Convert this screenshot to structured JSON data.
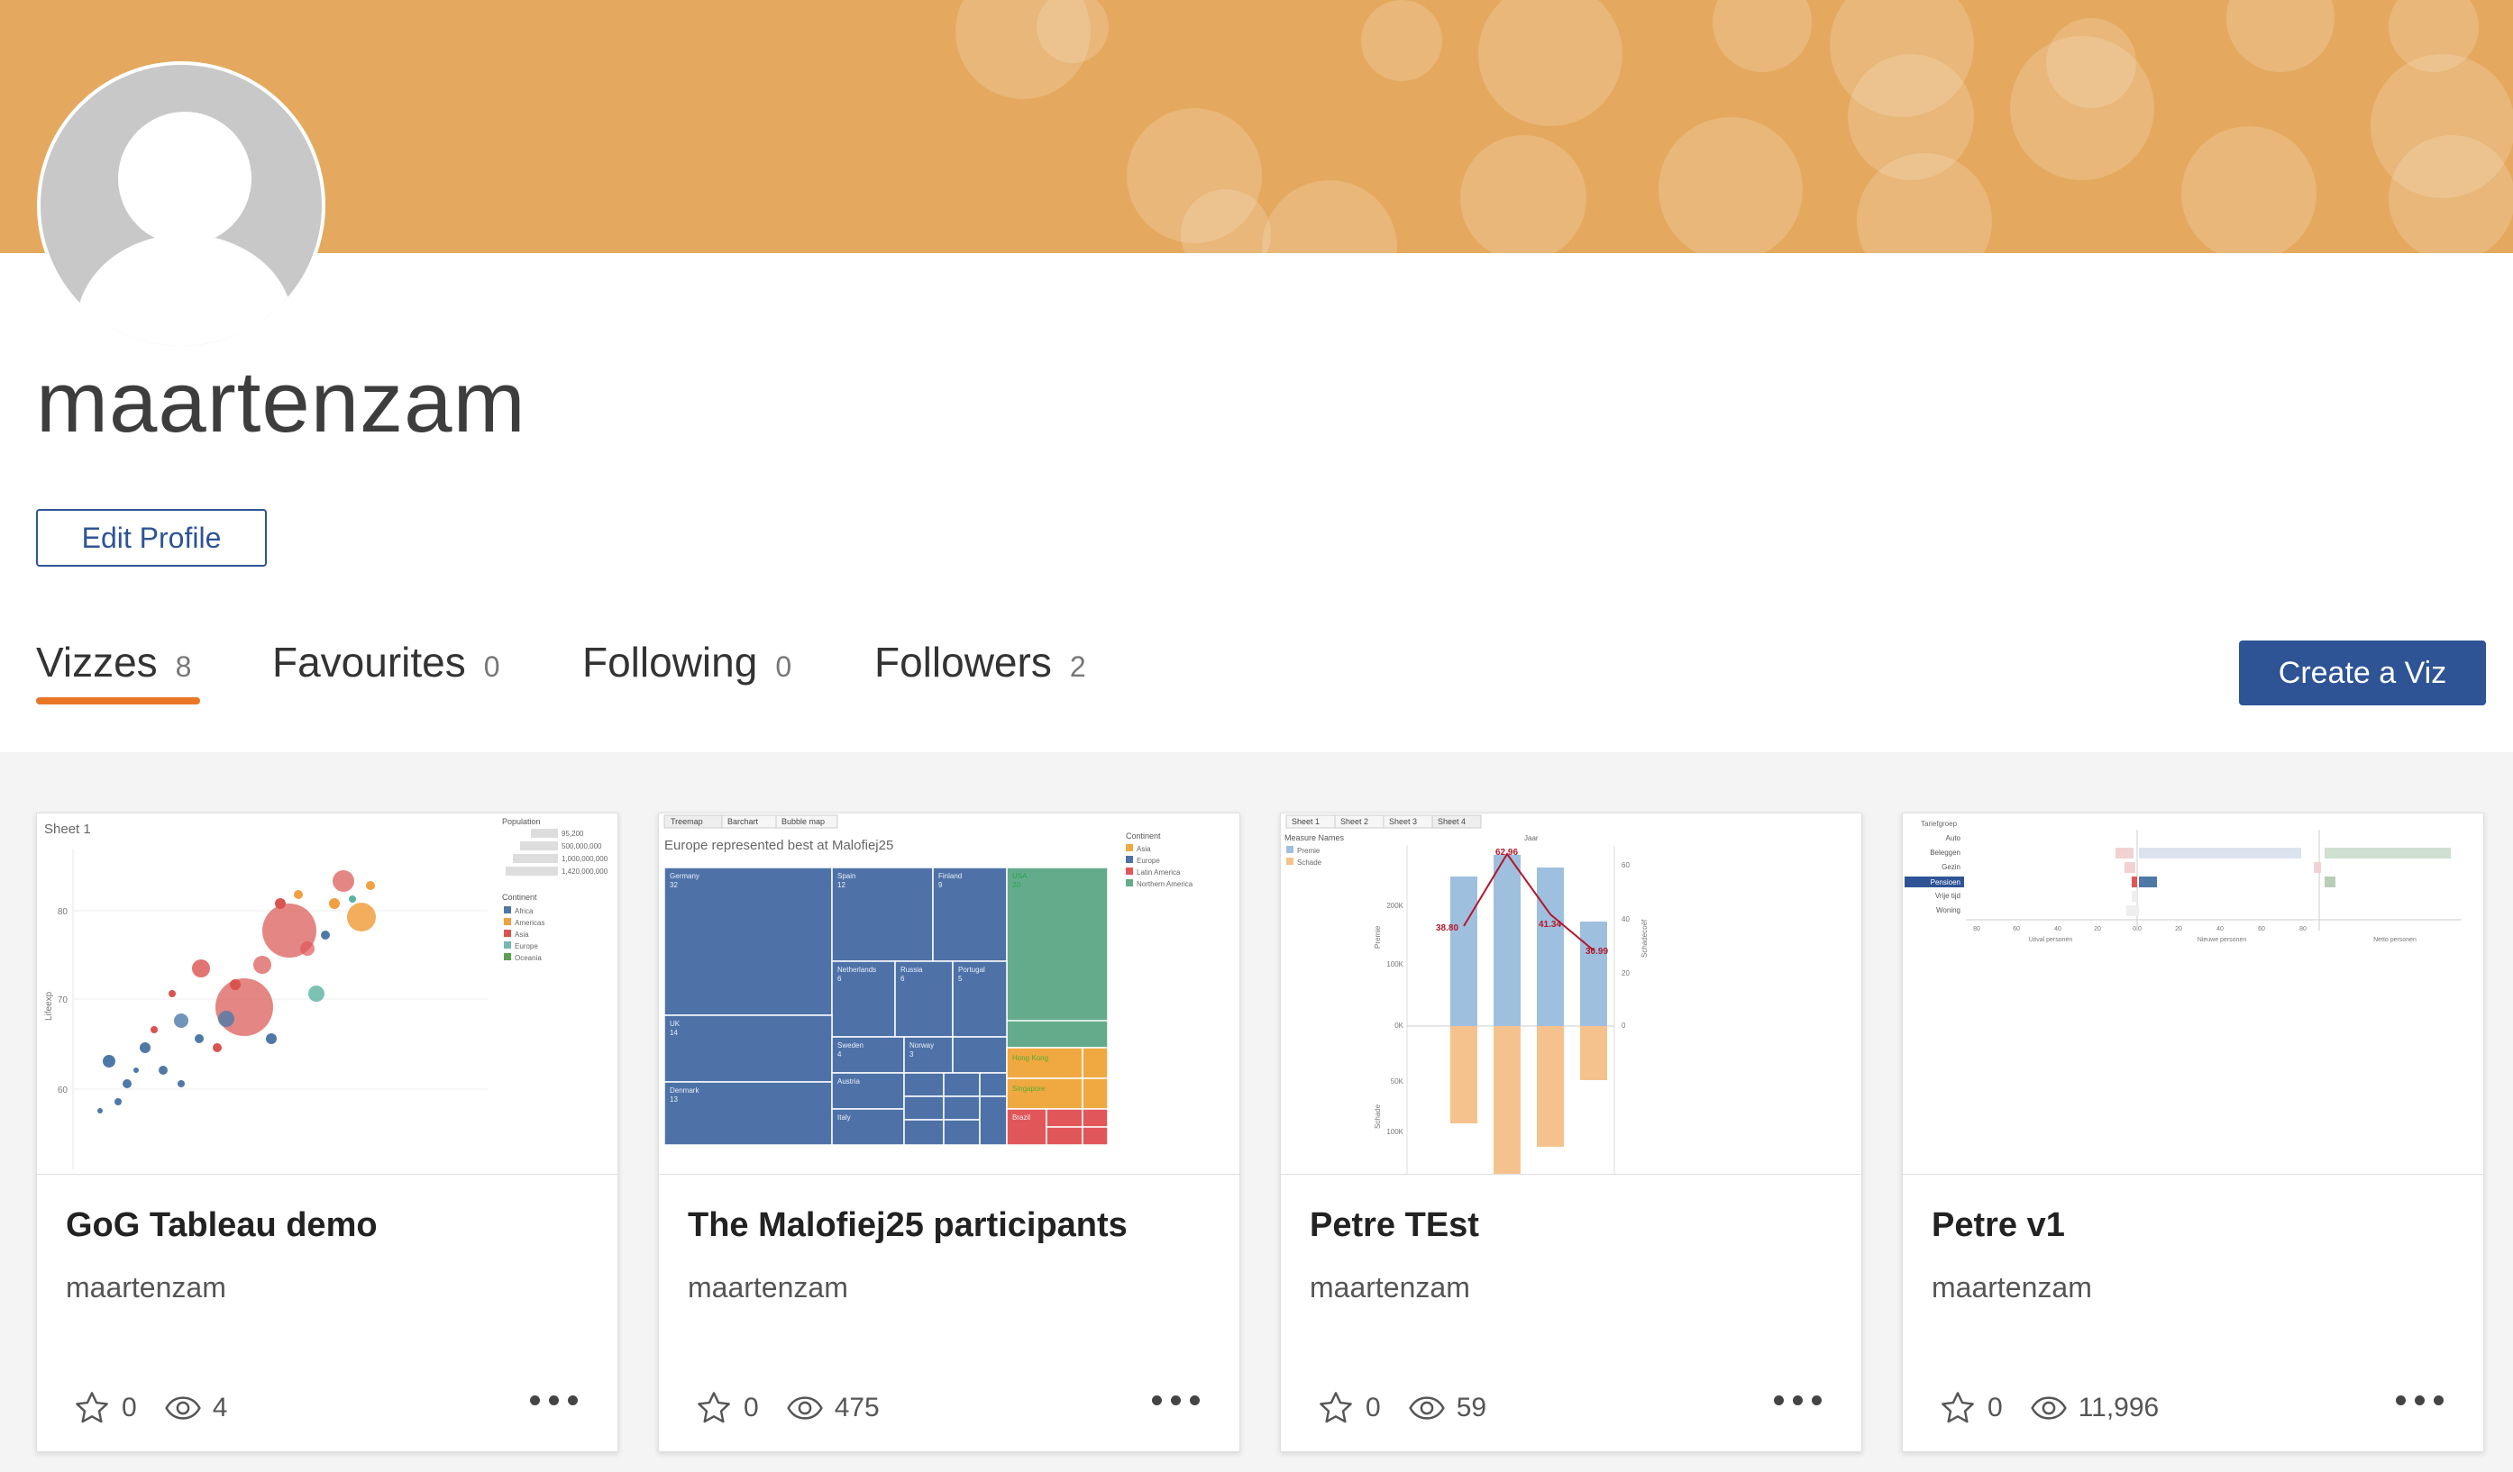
{
  "profile": {
    "username": "maartenzam",
    "edit_label": "Edit Profile",
    "banner_color": "#e4a95e"
  },
  "tabs": [
    {
      "label": "Vizzes",
      "count": "8",
      "active": true
    },
    {
      "label": "Favourites",
      "count": "0"
    },
    {
      "label": "Following",
      "count": "0"
    },
    {
      "label": "Followers",
      "count": "2"
    }
  ],
  "actions": {
    "create_label": "Create a Viz"
  },
  "accent": {
    "primary": "#2e5496",
    "tab_underline": "#e97627"
  },
  "cards": [
    {
      "title": "GoG Tableau demo",
      "author": "maartenzam",
      "favourites": "0",
      "views": "4",
      "thumb": {
        "sheet": "Sheet 1",
        "legend_size_title": "Population",
        "legend_size_items": [
          "95,200",
          "500,000,000",
          "1,000,000,000",
          "1,420,000,000"
        ],
        "legend_color_title": "Continent",
        "legend_color_items": [
          "Africa",
          "Americas",
          "Asia",
          "Europe",
          "Oceania"
        ],
        "y_title": "Lifeexp",
        "y_ticks": [
          "80",
          "70",
          "60"
        ]
      }
    },
    {
      "title": "The Malofiej25 participants",
      "author": "maartenzam",
      "favourites": "0",
      "views": "475",
      "thumb": {
        "tabs": [
          "Treemap",
          "Barchart",
          "Bubble map"
        ],
        "title": "Europe represented best at Malofiej25",
        "legend_title": "Continent",
        "legend_items": [
          "Asia",
          "Europe",
          "Latin America",
          "Northern America"
        ],
        "cells": [
          {
            "name": "Germany",
            "value": "32"
          },
          {
            "name": "Spain",
            "value": "12"
          },
          {
            "name": "Finland",
            "value": "9"
          },
          {
            "name": "USA",
            "value": "20"
          },
          {
            "name": "Netherlands",
            "value": "6"
          },
          {
            "name": "Russia",
            "value": "6"
          },
          {
            "name": "Portugal",
            "value": "5"
          },
          {
            "name": "UK",
            "value": "14"
          },
          {
            "name": "Sweden",
            "value": "4"
          },
          {
            "name": "Norway",
            "value": "3"
          },
          {
            "name": "Denmark",
            "value": "13"
          },
          {
            "name": "Austria",
            "value": ""
          },
          {
            "name": "Italy",
            "value": ""
          },
          {
            "name": "Hong Kong",
            "value": ""
          },
          {
            "name": "Singapore",
            "value": ""
          },
          {
            "name": "Brazil",
            "value": ""
          }
        ]
      }
    },
    {
      "title": "Petre TEst",
      "author": "maartenzam",
      "favourites": "0",
      "views": "59",
      "thumb": {
        "tabs": [
          "Sheet 1",
          "Sheet 2",
          "Sheet 3",
          "Sheet 4"
        ],
        "legend_title": "Measure Names",
        "legend_items": [
          "Premie",
          "Schade"
        ],
        "top_label": "Jaar",
        "line_labels": [
          "38.80",
          "62.96",
          "41.34",
          "30.99"
        ],
        "y_ticks": [
          "200K",
          "100K",
          "0K",
          "50K",
          "100K"
        ],
        "axis_titles": [
          "Premie",
          "Schade",
          "Schadecoëf"
        ],
        "right_ticks": [
          "60",
          "40",
          "20",
          "0"
        ]
      }
    },
    {
      "title": "Petre v1",
      "author": "maartenzam",
      "favourites": "0",
      "views": "11,996",
      "thumb": {
        "header": "Tariefgroep",
        "rows": [
          "Auto",
          "Beleggen",
          "Gezin",
          "Pensioen",
          "Vrije tijd",
          "Woning"
        ],
        "axis_titles": [
          "Uitval personen",
          "Nieuwe personen",
          "Netto personen"
        ],
        "ticks": [
          "80",
          "60",
          "40",
          "20",
          "0.0",
          "20",
          "40",
          "60",
          "80"
        ]
      }
    }
  ]
}
